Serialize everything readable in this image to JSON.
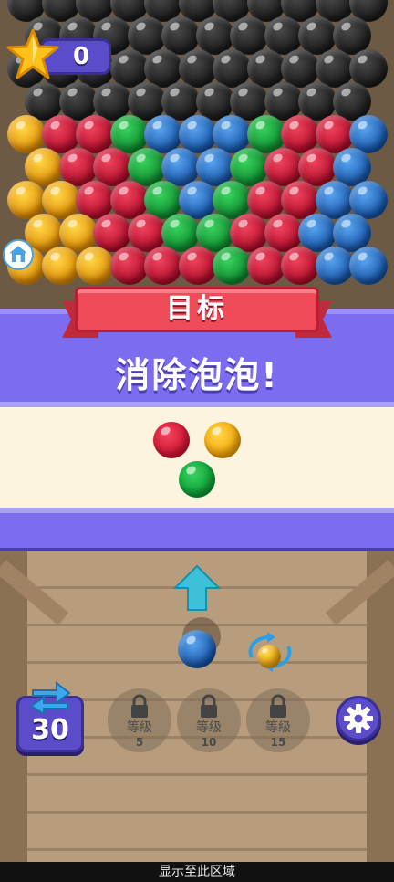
{
  "hud": {
    "score": "0"
  },
  "goal": {
    "ribbon_title": "目标",
    "instruction": "消除泡泡!",
    "target_colors": [
      "#d0102e",
      "#f0a000",
      "#0a9a34"
    ]
  },
  "launcher": {
    "swap_count": "30",
    "current_ball_color": "#1553a8",
    "next_ball_color": "#f0a000"
  },
  "locked_slots": [
    {
      "label": "等级",
      "level": "5"
    },
    {
      "label": "等级",
      "level": "10"
    },
    {
      "label": "等级",
      "level": "15"
    }
  ],
  "footer": {
    "text": "显示至此区域"
  },
  "board": {
    "rows": [
      "kkkkkkkkkkk",
      "kkkkkkkkkk",
      "kkkkkkkkkkk",
      "kkkkkkkkkk",
      "yrrgbbbgrrb",
      "yrrgbbgrrb",
      "yyrrgbgrrbb",
      "yyrrggrrbb",
      "yyyrrrgrrbb"
    ]
  },
  "icons": [
    "star-icon",
    "home-icon",
    "up-arrow-icon",
    "rotate-icon",
    "swap-icon",
    "lock-icon",
    "gear-icon"
  ]
}
